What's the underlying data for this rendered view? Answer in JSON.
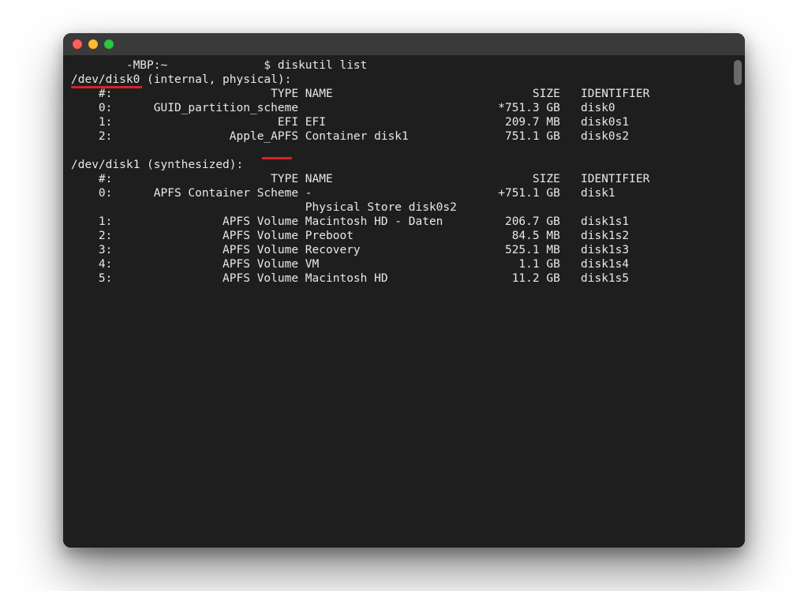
{
  "prompt": {
    "host": "-MBP:~",
    "user_marker": "$",
    "command": "diskutil list"
  },
  "annotations": {
    "underline1": "/dev/disk0",
    "underline2": "APFS"
  },
  "disks": [
    {
      "device": "/dev/disk0",
      "attrs": "(internal, physical):",
      "header": {
        "num": "#:",
        "type": "TYPE",
        "name": "NAME",
        "size": "SIZE",
        "ident": "IDENTIFIER"
      },
      "partitions": [
        {
          "num": "0:",
          "type": "GUID_partition_scheme",
          "name": "",
          "size": "*751.3 GB",
          "ident": "disk0"
        },
        {
          "num": "1:",
          "type": "EFI",
          "name": "EFI",
          "size": "209.7 MB",
          "ident": "disk0s1"
        },
        {
          "num": "2:",
          "type": "Apple_APFS",
          "name": "Container disk1",
          "size": "751.1 GB",
          "ident": "disk0s2"
        }
      ]
    },
    {
      "device": "/dev/disk1",
      "attrs": "(synthesized):",
      "header": {
        "num": "#:",
        "type": "TYPE",
        "name": "NAME",
        "size": "SIZE",
        "ident": "IDENTIFIER"
      },
      "partitions": [
        {
          "num": "0:",
          "type": "APFS Container Scheme",
          "name": "-",
          "size": "+751.1 GB",
          "ident": "disk1"
        },
        {
          "num": "",
          "type": "",
          "name": "Physical Store disk0s2",
          "size": "",
          "ident": ""
        },
        {
          "num": "1:",
          "type": "APFS Volume",
          "name": "Macintosh HD - Daten",
          "size": "206.7 GB",
          "ident": "disk1s1"
        },
        {
          "num": "2:",
          "type": "APFS Volume",
          "name": "Preboot",
          "size": "84.5 MB",
          "ident": "disk1s2"
        },
        {
          "num": "3:",
          "type": "APFS Volume",
          "name": "Recovery",
          "size": "525.1 MB",
          "ident": "disk1s3"
        },
        {
          "num": "4:",
          "type": "APFS Volume",
          "name": "VM",
          "size": "1.1 GB",
          "ident": "disk1s4"
        },
        {
          "num": "5:",
          "type": "APFS Volume",
          "name": "Macintosh HD",
          "size": "11.2 GB",
          "ident": "disk1s5"
        }
      ]
    }
  ]
}
